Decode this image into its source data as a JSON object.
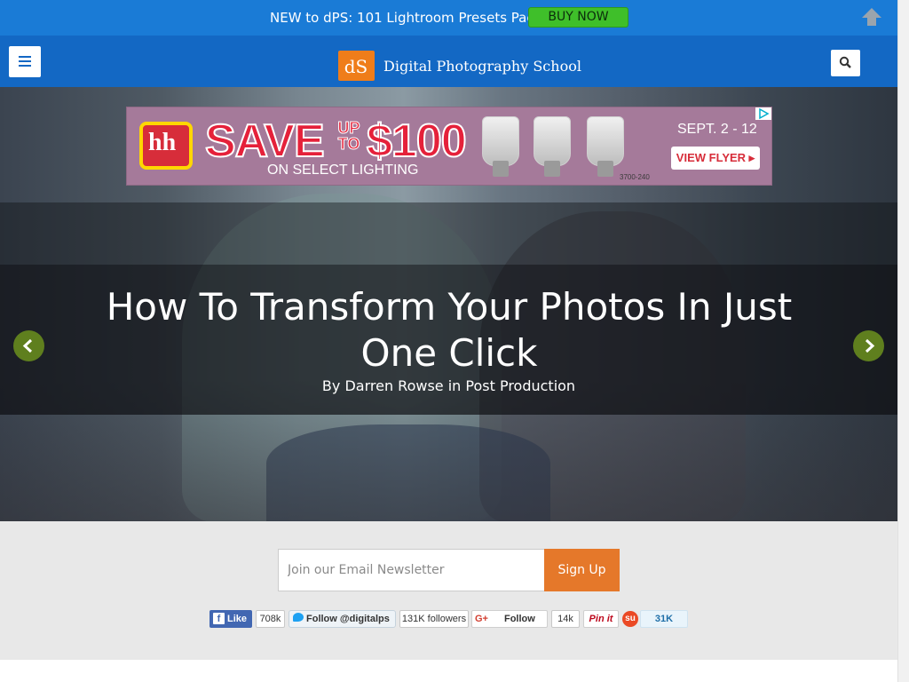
{
  "promo": {
    "text": "NEW to dPS: 101 Lightroom Presets Pack",
    "button": "BUY NOW"
  },
  "header": {
    "logo_mark": "dS",
    "site_name": "Digital Photography School"
  },
  "ad": {
    "logo_text": "hh",
    "save": "SAVE",
    "up_to": "UP TO",
    "amount": "$100",
    "subline": "ON SELECT LIGHTING",
    "dates": "SEPT. 2 - 12",
    "cta": "VIEW FLYER ▸",
    "code": "3700-240"
  },
  "hero": {
    "title": "How To Transform Your Photos In Just One Click",
    "byline": "By Darren Rowse in Post Production"
  },
  "newsletter": {
    "placeholder": "Join our Email Newsletter",
    "button": "Sign Up"
  },
  "social": {
    "facebook_label": "Like",
    "facebook_count": "708k",
    "twitter_label": "Follow @digitalps",
    "twitter_count": "131K followers",
    "google_label": "Follow",
    "google_count": "14k",
    "pinterest_label": "Pin it",
    "stumble_count": "31K"
  },
  "colors": {
    "promo_bar": "#1a7bd6",
    "header": "#1368c4",
    "buy_now": "#3fbf2a",
    "logo_accent": "#ef7d1a",
    "signup": "#e5782a",
    "slider_arrow": "#5f7f1e"
  },
  "icons": [
    "arrow-up-icon",
    "hamburger-icon",
    "search-icon",
    "chevron-left-icon",
    "chevron-right-icon",
    "facebook-icon",
    "twitter-icon",
    "google-plus-icon",
    "pinterest-icon",
    "stumbleupon-icon",
    "adchoices-icon"
  ]
}
